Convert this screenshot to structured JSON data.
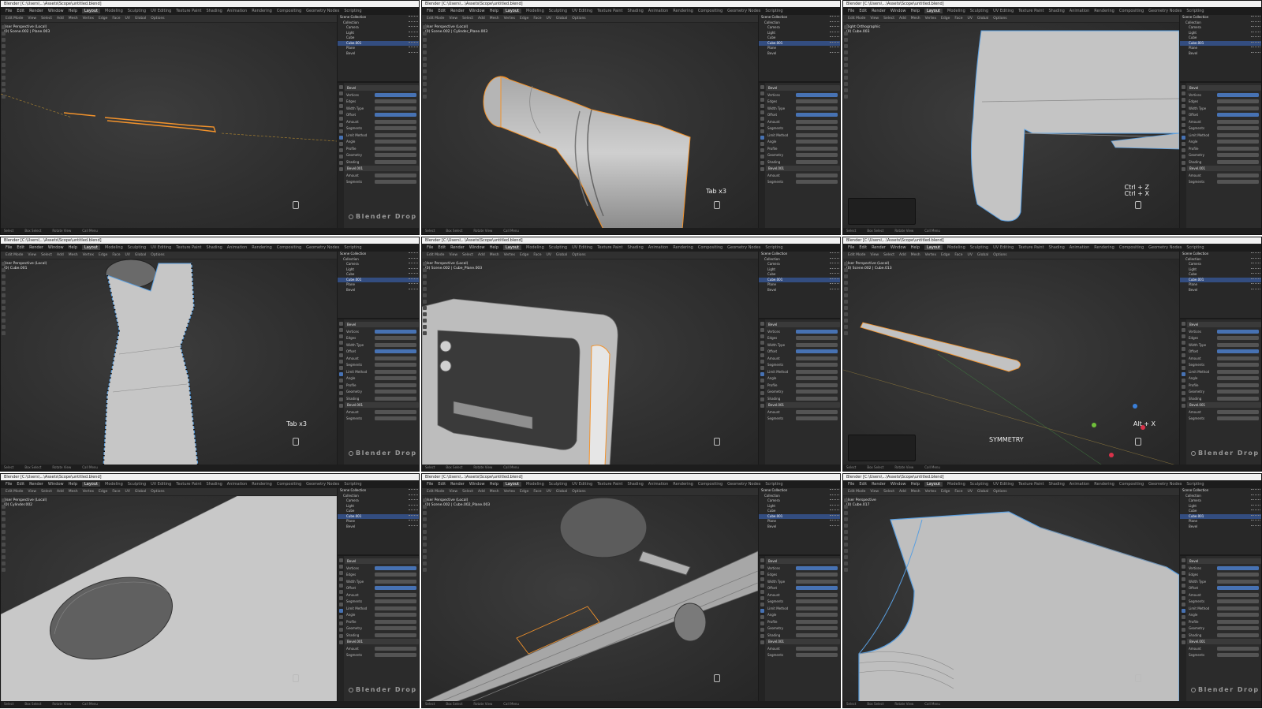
{
  "app": {
    "title": "Blender [C:\\Users\\...\\Assets\\Scope\\untitled.blend]",
    "menus": [
      "File",
      "Edit",
      "Render",
      "Window",
      "Help"
    ],
    "workspaces": [
      "Layout",
      "Modeling",
      "Sculpting",
      "UV Editing",
      "Texture Paint",
      "Shading",
      "Animation",
      "Rendering",
      "Compositing",
      "Geometry Nodes",
      "Scripting"
    ],
    "active_workspace": "Layout",
    "toolbar_items": [
      "Edit Mode",
      "View",
      "Select",
      "Add",
      "Mesh",
      "Vertex",
      "Edge",
      "Face",
      "UV",
      "Global",
      "Options"
    ],
    "status_items": [
      "Select",
      "Box Select",
      "Rotate View",
      "Call Menu"
    ],
    "watermark": "Blender Drop"
  },
  "tiles": [
    {
      "viewport_title": "User Perspective (Local)",
      "viewport_subtitle": "(0) Scene.002 | Plane.003",
      "key_hint": "",
      "object": "thin-plane"
    },
    {
      "viewport_title": "User Perspective (Local)",
      "viewport_subtitle": "(0) Scene.002 | Cylinder_Plane.003",
      "key_hint": "Tab x3",
      "object": "cylinder"
    },
    {
      "viewport_title": "Right Orthographic",
      "viewport_subtitle": "(0) Cube.003",
      "key_hint": "Ctrl + Z\nCtrl + X",
      "object": "block-corner"
    },
    {
      "viewport_title": "User Perspective (Local)",
      "viewport_subtitle": "(0) Cube.001",
      "key_hint": "Tab x3",
      "object": "grip-outline"
    },
    {
      "viewport_title": "User Perspective (Local)",
      "viewport_subtitle": "(0) Scene.002 | Cube_Plane.003",
      "key_hint": "",
      "object": "frame"
    },
    {
      "viewport_title": "User Perspective (Local)",
      "viewport_subtitle": "(0) Scene.002 | Cube.013",
      "key_hint": "Alt + X",
      "object": "bar",
      "caption": "SYMMETRY"
    },
    {
      "viewport_title": "User Perspective (Local)",
      "viewport_subtitle": "(0) Cylinder.002",
      "key_hint": "",
      "object": "hole"
    },
    {
      "viewport_title": "User Perspective (Local)",
      "viewport_subtitle": "(0) Scene.002 | Cube.002_Plane.003",
      "key_hint": "",
      "object": "rail"
    },
    {
      "viewport_title": "User Perspective",
      "viewport_subtitle": "(0) Cube.017",
      "key_hint": "",
      "object": "stock"
    }
  ],
  "outliner_rows": [
    "Scene Collection",
    "Collection",
    "Camera",
    "Light",
    "Cube",
    "Cube.001",
    "Plane",
    "Bevel"
  ],
  "properties_rows": [
    "Bevel",
    "Vertices",
    "Edges",
    "Width Type",
    "Offset",
    "Amount",
    "Segments",
    "Limit Method",
    "Angle",
    "Profile",
    "Geometry",
    "Shading",
    "Bevel.001",
    "Amount",
    "Segments"
  ],
  "colors": {
    "selection": "#f2922b",
    "bluewire": "#5a9fe0",
    "active_tab": "#4772b3"
  }
}
